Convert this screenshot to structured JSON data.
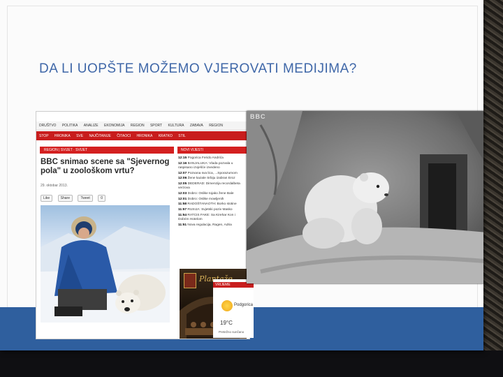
{
  "slide": {
    "title": "DA LI UOPŠTE MOŽEMO VJEROVATI MEDIJIMA?"
  },
  "news_site": {
    "nav_primary": [
      "DRUŠTVO",
      "POLITIKA",
      "ANALIZE",
      "EKONOMIJA",
      "REGION",
      "SPORT",
      "KULTURA",
      "ZABAVA",
      "REGION"
    ],
    "nav_secondary": [
      "STOP",
      "HRONIKA",
      "SVE",
      "NAJČITANIJE",
      "ČITAOCI",
      "HRONIKA",
      "KRATKO",
      "STIL"
    ],
    "section_label": "REGION | SVIJET · SVIJET",
    "sidebar_label": "NOVI VIJESTI",
    "headline": "BBC snimao scene sa \"Sjevernog pola\" u zoološkom vrtu?",
    "dateline": "29. oktobar 2013.",
    "share_buttons": [
      "Like",
      "Share",
      "Tweet",
      "0"
    ],
    "ticker": [
      {
        "time": "12:15",
        "text": "Pogorica Ferido Andrića"
      },
      {
        "time": "12:16",
        "text": "BANJALUKA: Vlada pozvala u raspisano izvješće izvedeno"
      },
      {
        "time": "12:07",
        "text": "Pozvana sva lica, ...Sporazumom"
      },
      {
        "time": "12:06",
        "text": "Žene kazale Srbiju izabran Eroz"
      },
      {
        "time": "12:05",
        "text": "DEDERAD: Dimenzija recordalbeta verzova"
      },
      {
        "time": "12:03",
        "text": "Dobro: Oslike tojako žene Bale"
      },
      {
        "time": "12:01",
        "text": "Dobro: Oslike mowljenih"
      },
      {
        "time": "11:58",
        "text": "RADOŠTANAOTH: Borko stotine"
      },
      {
        "time": "11:57",
        "text": "RUSIJA: Svjetski poziv Masko"
      },
      {
        "time": "11:54",
        "text": "RATCIS FAKE: Sa Kirehar Kon i Dobrim Hotelom"
      },
      {
        "time": "11:51",
        "text": "Nova regulacija, Ragen, Adria"
      }
    ],
    "ad_text": "Plantaže",
    "weather": {
      "header": "VRIJEME",
      "city": "Podgorica",
      "temp": "19°C",
      "note": "Pretežno sunčano"
    }
  },
  "overlay_photo": {
    "watermark": "BBC"
  }
}
